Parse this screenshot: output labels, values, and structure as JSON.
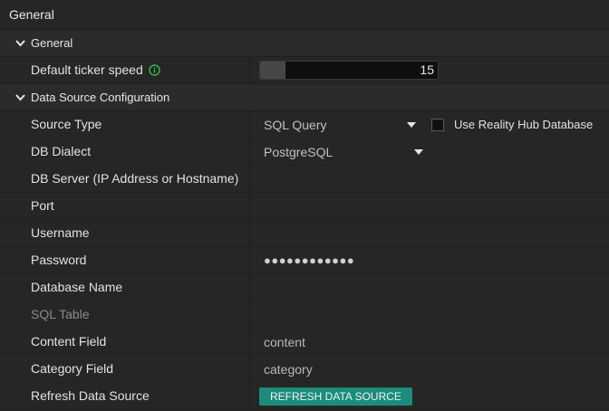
{
  "page": {
    "title": "General"
  },
  "sections": {
    "general": {
      "label": "General",
      "default_ticker_speed": {
        "label": "Default ticker speed",
        "value": "15"
      }
    },
    "data_source": {
      "label": "Data Source Configuration",
      "source_type": {
        "label": "Source Type",
        "value": "SQL Query",
        "use_reality_hub_label": "Use Reality Hub Database",
        "use_reality_hub_checked": false
      },
      "db_dialect": {
        "label": "DB Dialect",
        "value": "PostgreSQL"
      },
      "db_server": {
        "label": "DB Server (IP Address or Hostname)",
        "value": ""
      },
      "port": {
        "label": "Port",
        "value": ""
      },
      "username": {
        "label": "Username",
        "value": ""
      },
      "password": {
        "label": "Password",
        "value": "●●●●●●●●●●●●"
      },
      "database_name": {
        "label": "Database Name",
        "value": ""
      },
      "sql_table": {
        "label": "SQL Table",
        "value": ""
      },
      "content_field": {
        "label": "Content Field",
        "value": "content"
      },
      "category_field": {
        "label": "Category Field",
        "value": "category"
      },
      "refresh": {
        "label": "Refresh Data Source",
        "button_label": "REFRESH DATA SOURCE"
      }
    }
  },
  "colors": {
    "background": "#262626",
    "accent_button": "#1b8c7c",
    "info_icon": "#2fbf4f"
  },
  "icons": {
    "section_toggle": "chevron-down-icon",
    "info": "info-icon",
    "dropdown": "caret-down-icon"
  }
}
